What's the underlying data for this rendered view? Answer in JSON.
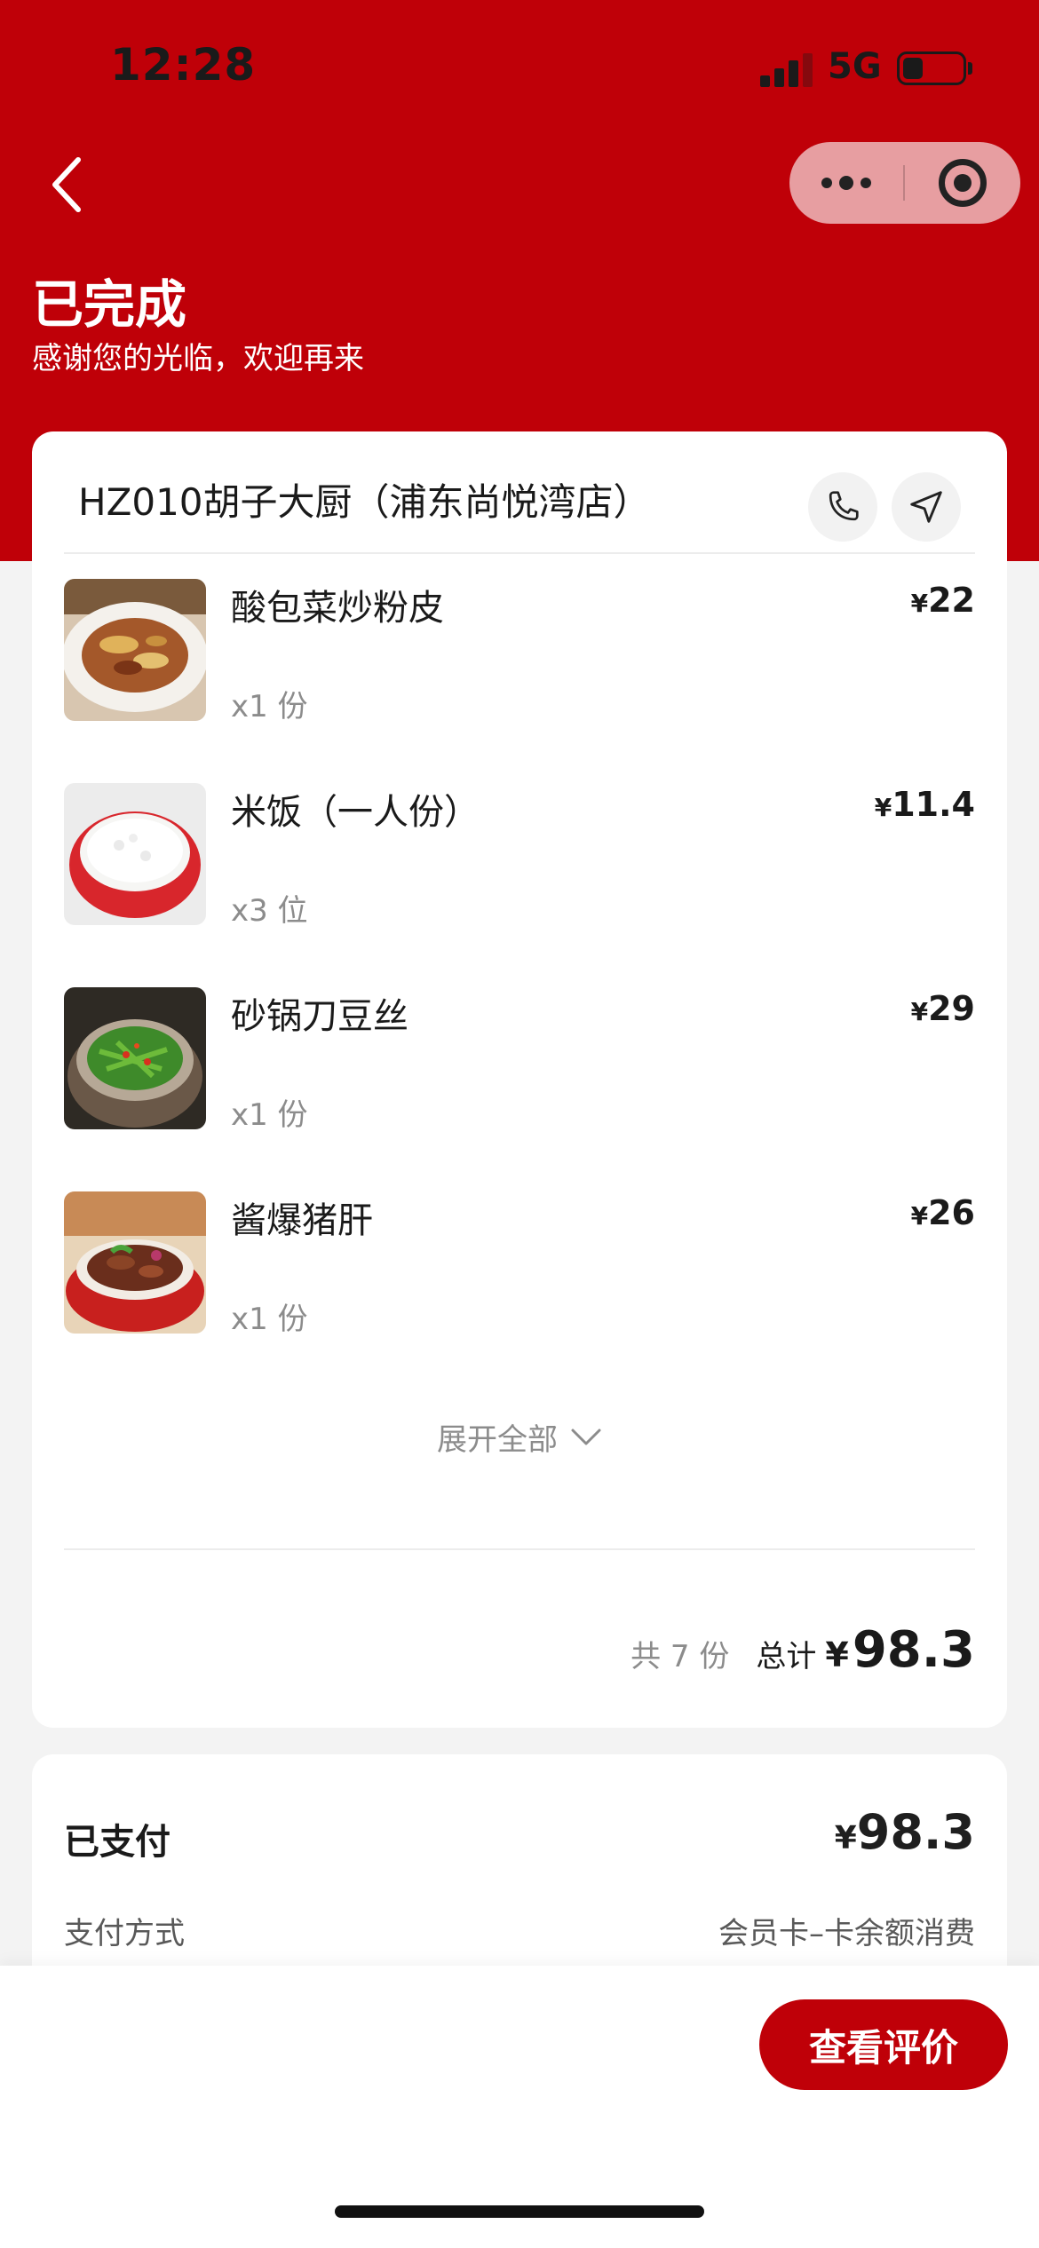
{
  "status_bar": {
    "time": "12:28",
    "network": "5G"
  },
  "header": {
    "status_title": "已完成",
    "status_subtitle": "感谢您的光临，欢迎再来"
  },
  "store": {
    "name": "HZ010胡子大厨（浦东尚悦湾店）"
  },
  "items": [
    {
      "name": "酸包菜炒粉皮",
      "quantity": "x1 份",
      "price": "22",
      "currency": "¥"
    },
    {
      "name": "米饭（一人份）",
      "quantity": "x3 位",
      "price": "11.4",
      "currency": "¥"
    },
    {
      "name": "砂锅刀豆丝",
      "quantity": "x1 份",
      "price": "29",
      "currency": "¥"
    },
    {
      "name": "酱爆猪肝",
      "quantity": "x1 份",
      "price": "26",
      "currency": "¥"
    }
  ],
  "expand_label": "展开全部",
  "summary": {
    "count_text": "共 7 份",
    "total_label": "总计",
    "currency": "¥",
    "total": "98.3"
  },
  "payment": {
    "paid_label": "已支付",
    "currency": "¥",
    "paid_amount": "98.3",
    "method_label": "支付方式",
    "method_value": "会员卡–卡余额消费"
  },
  "actions": {
    "review_label": "查看评价"
  },
  "colors": {
    "brand_red": "#bf0008"
  }
}
